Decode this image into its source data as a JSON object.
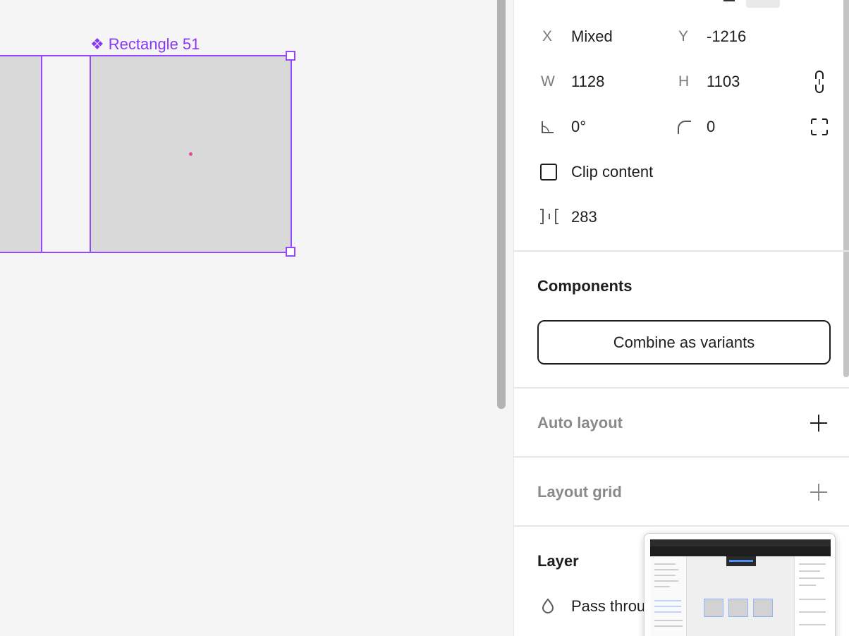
{
  "canvas": {
    "frame_label": "Rectangle 51",
    "component_glyph": "❖"
  },
  "panel": {
    "x_label": "X",
    "x_value": "Mixed",
    "y_label": "Y",
    "y_value": "-1216",
    "w_label": "W",
    "w_value": "1128",
    "h_label": "H",
    "h_value": "1103",
    "rotation_value": "0°",
    "radius_value": "0",
    "clip_label": "Clip content",
    "spacing_value": "283",
    "components_title": "Components",
    "combine_label": "Combine as variants",
    "auto_layout_title": "Auto layout",
    "layout_grid_title": "Layout grid",
    "layer_title": "Layer",
    "blend_value": "Pass throu"
  },
  "icons": [
    "component-icon",
    "constrain-proportions-icon",
    "rotation-icon",
    "corner-radius-icon",
    "independent-corners-icon",
    "spacing-icon",
    "plus-icon",
    "blend-drop-icon"
  ],
  "colors": {
    "selection": "#9747ff",
    "label_purple": "#8a38f5",
    "rect_fill": "#d9d9d9",
    "canvas_bg": "#f5f5f5"
  }
}
